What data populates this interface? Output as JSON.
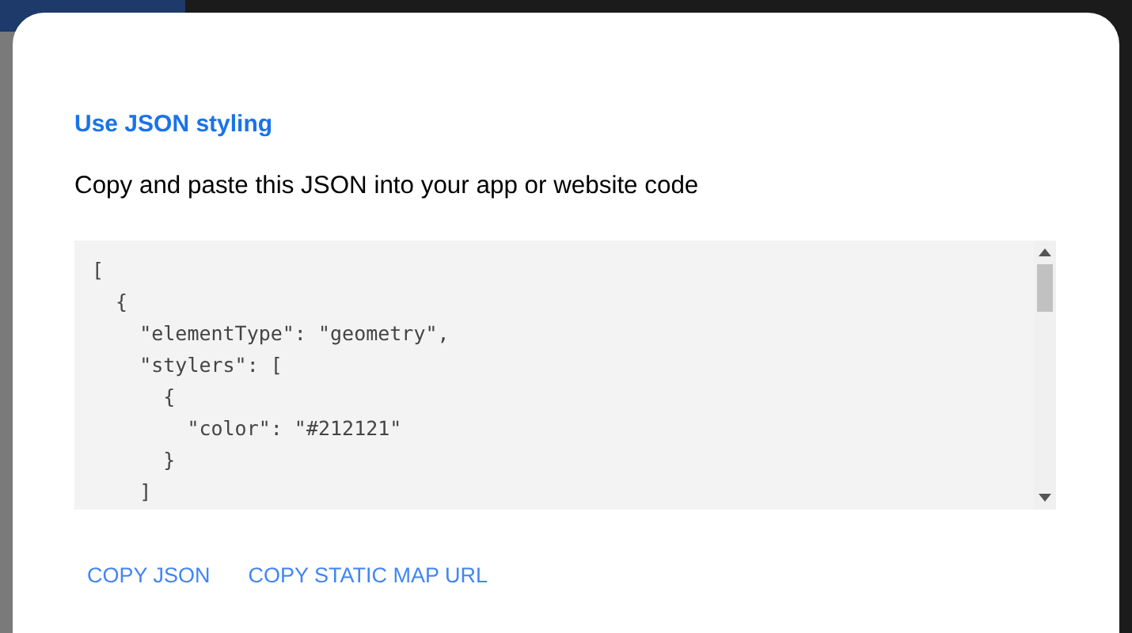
{
  "dialog": {
    "title": "Use JSON styling",
    "description": "Copy and paste this JSON into your app or website code",
    "code_lines": [
      "[",
      "  {",
      "    \"elementType\": \"geometry\",",
      "    \"stylers\": [",
      "      {",
      "        \"color\": \"#212121\"",
      "      }",
      "    ]"
    ],
    "buttons": [
      "COPY JSON",
      "COPY STATIC MAP URL"
    ]
  }
}
